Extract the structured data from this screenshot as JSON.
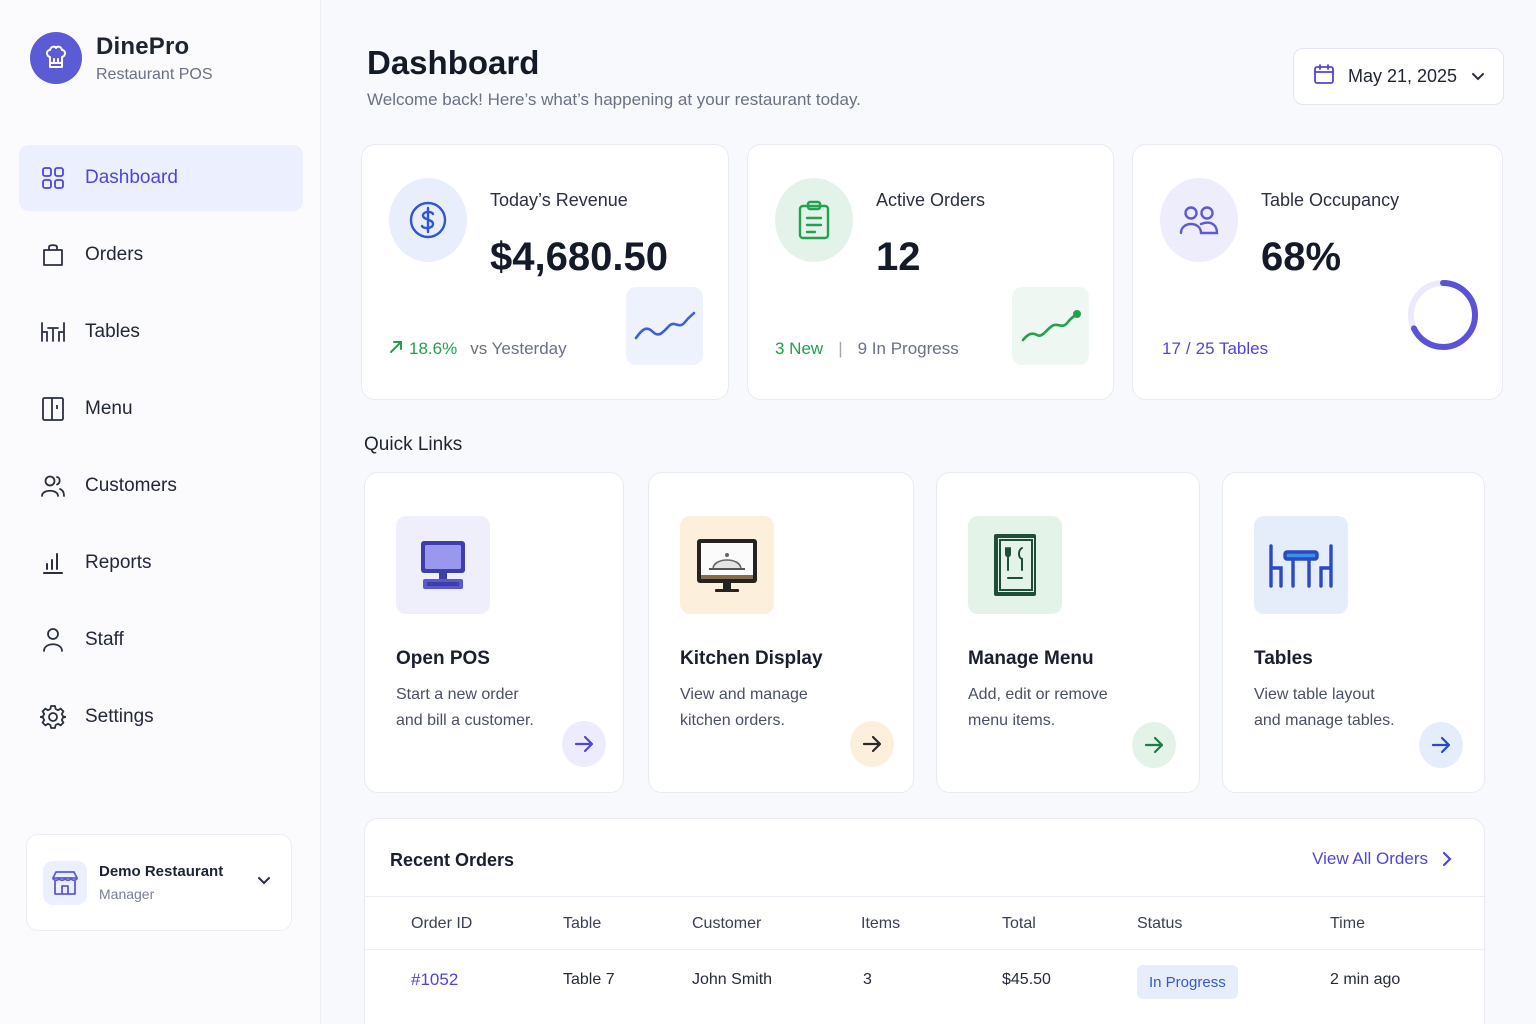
{
  "brand": {
    "name": "DinePro",
    "subtitle": "Restaurant POS"
  },
  "sidebar": {
    "items": [
      {
        "label": "Dashboard",
        "icon": "grid-icon",
        "active": true
      },
      {
        "label": "Orders",
        "icon": "bag-icon"
      },
      {
        "label": "Tables",
        "icon": "table-icon"
      },
      {
        "label": "Menu",
        "icon": "book-icon"
      },
      {
        "label": "Customers",
        "icon": "users-icon"
      },
      {
        "label": "Reports",
        "icon": "bar-chart-icon"
      },
      {
        "label": "Staff",
        "icon": "user-icon"
      },
      {
        "label": "Settings",
        "icon": "gear-icon"
      }
    ],
    "account": {
      "name": "Demo Restaurant",
      "role": "Manager"
    }
  },
  "header": {
    "title": "Dashboard",
    "subtitle": "Welcome back! Here’s what’s happening at your restaurant today.",
    "date": "May 21, 2025"
  },
  "stats": {
    "revenue": {
      "label": "Today’s Revenue",
      "value": "$4,680.50",
      "change": "18.6%",
      "compare": "vs Yesterday"
    },
    "orders": {
      "label": "Active Orders",
      "value": "12",
      "new": "3 New",
      "separator": "|",
      "in_progress": "9 In Progress"
    },
    "occupancy": {
      "label": "Table Occupancy",
      "value": "68%",
      "occupied": "17",
      "slash": "/",
      "total": "25 Tables",
      "fraction": 0.68
    }
  },
  "quick_links": {
    "title": "Quick Links",
    "items": [
      {
        "title": "Open POS",
        "description": "Start a new order and bill a customer."
      },
      {
        "title": "Kitchen Display",
        "description": "View and manage kitchen orders."
      },
      {
        "title": "Manage Menu",
        "description": "Add, edit or remove menu items."
      },
      {
        "title": "Tables",
        "description": "View table layout and manage tables."
      }
    ]
  },
  "recent_orders": {
    "title": "Recent Orders",
    "view_all": "View All Orders",
    "columns": [
      "Order ID",
      "Table",
      "Customer",
      "Items",
      "Total",
      "Status",
      "Time"
    ],
    "rows": [
      {
        "id": "#1052",
        "table": "Table 7",
        "customer": "John Smith",
        "items": "3",
        "total": "$45.50",
        "status": "In Progress",
        "time": "2 min ago"
      }
    ]
  },
  "colors": {
    "accent": "#4f46d8",
    "brand_logo": "#5b5bd6",
    "positive": "#22a04b",
    "orange": "#f8ecd9",
    "green_bg": "#e4f3ea",
    "blue_bg": "#e7edfb"
  }
}
